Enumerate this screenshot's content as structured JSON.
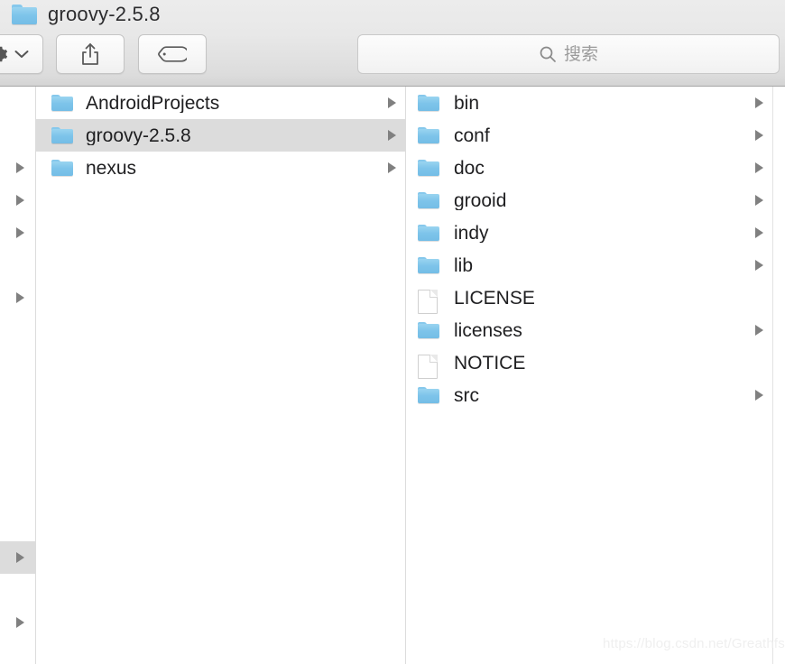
{
  "window": {
    "title": "groovy-2.5.8",
    "title_icon": "folder-icon"
  },
  "toolbar": {
    "action_button": {
      "name": "action-gear-button",
      "icon": "gear-icon",
      "chevron": "chevron-down-icon"
    },
    "share_button": {
      "name": "share-button",
      "icon": "share-icon"
    },
    "tag_button": {
      "name": "tag-button",
      "icon": "tag-icon"
    },
    "search": {
      "icon": "search-icon",
      "placeholder": "搜索",
      "value": ""
    }
  },
  "columns": [
    {
      "name": "column-1",
      "items": [
        {
          "label": "",
          "type": "folder",
          "has_chevron": false,
          "selected": false
        },
        {
          "label": "",
          "type": "folder",
          "has_chevron": false,
          "selected": false
        },
        {
          "label": "",
          "type": "folder",
          "has_chevron": true,
          "selected": false
        },
        {
          "label": "",
          "type": "folder",
          "has_chevron": true,
          "selected": false
        },
        {
          "label": "",
          "type": "folder",
          "has_chevron": true,
          "selected": false
        },
        {
          "label": "",
          "type": "folder",
          "has_chevron": false,
          "selected": false
        },
        {
          "label": "",
          "type": "folder",
          "has_chevron": true,
          "selected": false
        },
        {
          "label": "",
          "type": "folder",
          "has_chevron": false,
          "selected": false
        },
        {
          "label": "",
          "type": "folder",
          "has_chevron": false,
          "selected": false
        },
        {
          "label": "",
          "type": "folder",
          "has_chevron": false,
          "selected": false
        },
        {
          "label": "",
          "type": "folder",
          "has_chevron": false,
          "selected": false
        },
        {
          "label": "",
          "type": "folder",
          "has_chevron": false,
          "selected": false
        },
        {
          "label": "",
          "type": "folder",
          "has_chevron": false,
          "selected": false
        },
        {
          "label": "",
          "type": "folder",
          "has_chevron": false,
          "selected": false
        },
        {
          "label": "",
          "type": "folder",
          "has_chevron": true,
          "selected": true
        },
        {
          "label": "",
          "type": "folder",
          "has_chevron": false,
          "selected": false
        },
        {
          "label": "",
          "type": "folder",
          "has_chevron": true,
          "selected": false
        }
      ]
    },
    {
      "name": "column-2",
      "items": [
        {
          "label": "AndroidProjects",
          "type": "folder",
          "has_chevron": true,
          "selected": false
        },
        {
          "label": "groovy-2.5.8",
          "type": "folder",
          "has_chevron": true,
          "selected": true
        },
        {
          "label": "nexus",
          "type": "folder",
          "has_chevron": true,
          "selected": false
        }
      ]
    },
    {
      "name": "column-3",
      "items": [
        {
          "label": "bin",
          "type": "folder",
          "has_chevron": true,
          "selected": false
        },
        {
          "label": "conf",
          "type": "folder",
          "has_chevron": true,
          "selected": false
        },
        {
          "label": "doc",
          "type": "folder",
          "has_chevron": true,
          "selected": false
        },
        {
          "label": "grooid",
          "type": "folder",
          "has_chevron": true,
          "selected": false
        },
        {
          "label": "indy",
          "type": "folder",
          "has_chevron": true,
          "selected": false
        },
        {
          "label": "lib",
          "type": "folder",
          "has_chevron": true,
          "selected": false
        },
        {
          "label": "LICENSE",
          "type": "file",
          "has_chevron": false,
          "selected": false
        },
        {
          "label": "licenses",
          "type": "folder",
          "has_chevron": true,
          "selected": false
        },
        {
          "label": "NOTICE",
          "type": "file",
          "has_chevron": false,
          "selected": false
        },
        {
          "label": "src",
          "type": "folder",
          "has_chevron": true,
          "selected": false
        }
      ]
    }
  ],
  "watermark": {
    "text": "https://blog.csdn.net/Greathfs"
  },
  "colors": {
    "folder_blue": "#7dc4ea",
    "selection_gray": "#dcdcdc",
    "text": "#1f1f21",
    "placeholder": "#9b9b9b",
    "chevron": "#808080"
  }
}
